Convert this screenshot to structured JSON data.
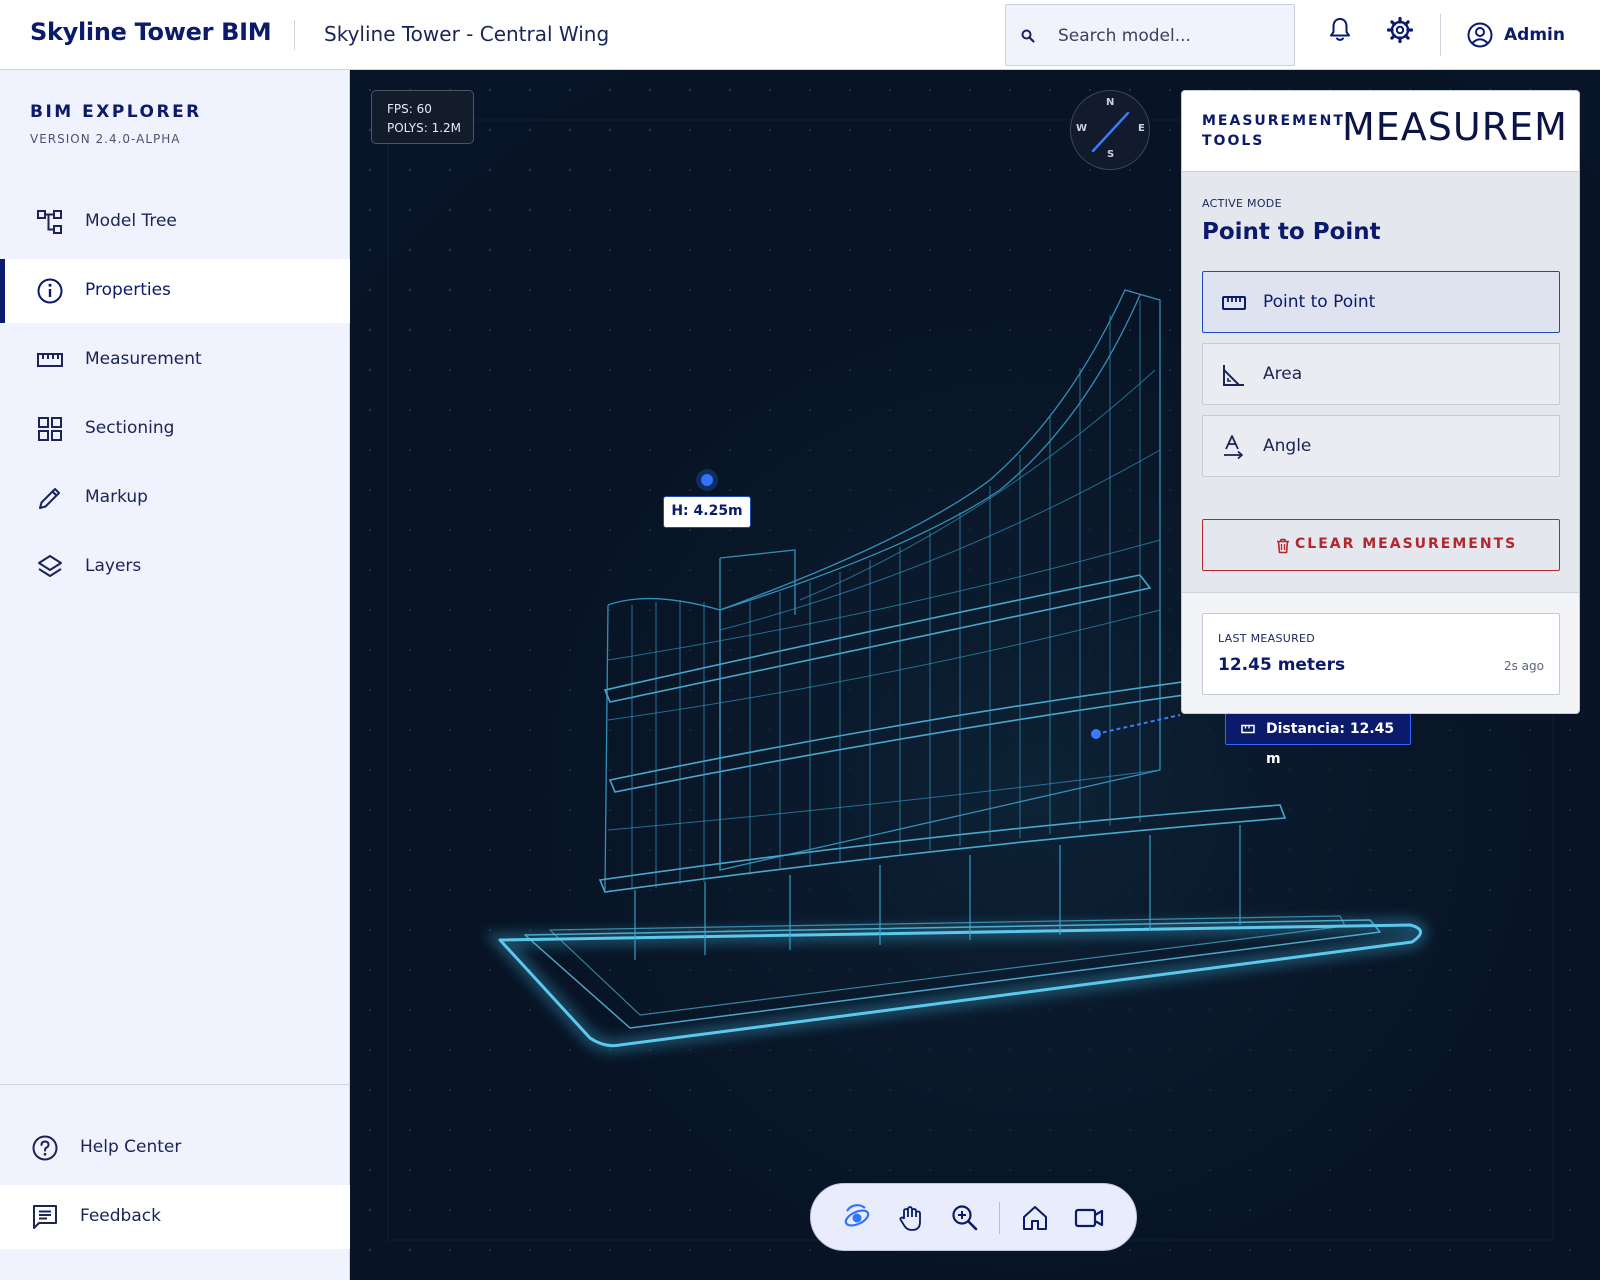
{
  "header": {
    "brand": "Skyline Tower BIM",
    "project": "Skyline Tower - Central Wing",
    "search_placeholder": "Search model...",
    "user_label": "Admin"
  },
  "sidebar": {
    "title": "BIM EXPLORER",
    "version": "VERSION 2.4.0-ALPHA",
    "items": [
      {
        "label": "Model Tree",
        "icon": "tree-icon"
      },
      {
        "label": "Properties",
        "icon": "info-icon",
        "active": true
      },
      {
        "label": "Measurement",
        "icon": "ruler-icon"
      },
      {
        "label": "Sectioning",
        "icon": "grid-icon"
      },
      {
        "label": "Markup",
        "icon": "pencil-icon"
      },
      {
        "label": "Layers",
        "icon": "layers-icon"
      }
    ],
    "bottom_items": [
      {
        "label": "Help Center",
        "icon": "help-icon"
      },
      {
        "label": "Feedback",
        "icon": "feedback-icon"
      }
    ]
  },
  "viewport": {
    "fps": "FPS: 60",
    "polys": "POLYS: 1.2M",
    "compass": {
      "n": "N",
      "s": "S",
      "e": "E",
      "w": "W"
    },
    "point_label": "H: 4.25m",
    "distance_label": "Distancia: 12.45 m",
    "toolbar_icons": [
      "orbit-icon",
      "pan-icon",
      "zoom-icon",
      "home-icon",
      "camera-icon"
    ]
  },
  "measurement_panel": {
    "title": "MEASUREMENT TOOLS",
    "header_ghost_text": "MEASUREM",
    "active_mode_caption": "ACTIVE MODE",
    "active_mode_value": "Point to Point",
    "tools": [
      {
        "label": "Point to Point",
        "icon": "ruler-icon",
        "active": true
      },
      {
        "label": "Area",
        "icon": "area-icon"
      },
      {
        "label": "Angle",
        "icon": "angle-icon"
      }
    ],
    "clear_label": "CLEAR MEASUREMENTS",
    "last_caption": "LAST MEASURED",
    "last_value": "12.45 meters",
    "last_time": "2s ago"
  },
  "colors": {
    "brand_navy": "#0b1a6b",
    "accent_blue": "#1f4db8",
    "danger_red": "#b3262d",
    "viewport_bg": "#081427",
    "wireframe_cyan": "#3fb6e0"
  }
}
